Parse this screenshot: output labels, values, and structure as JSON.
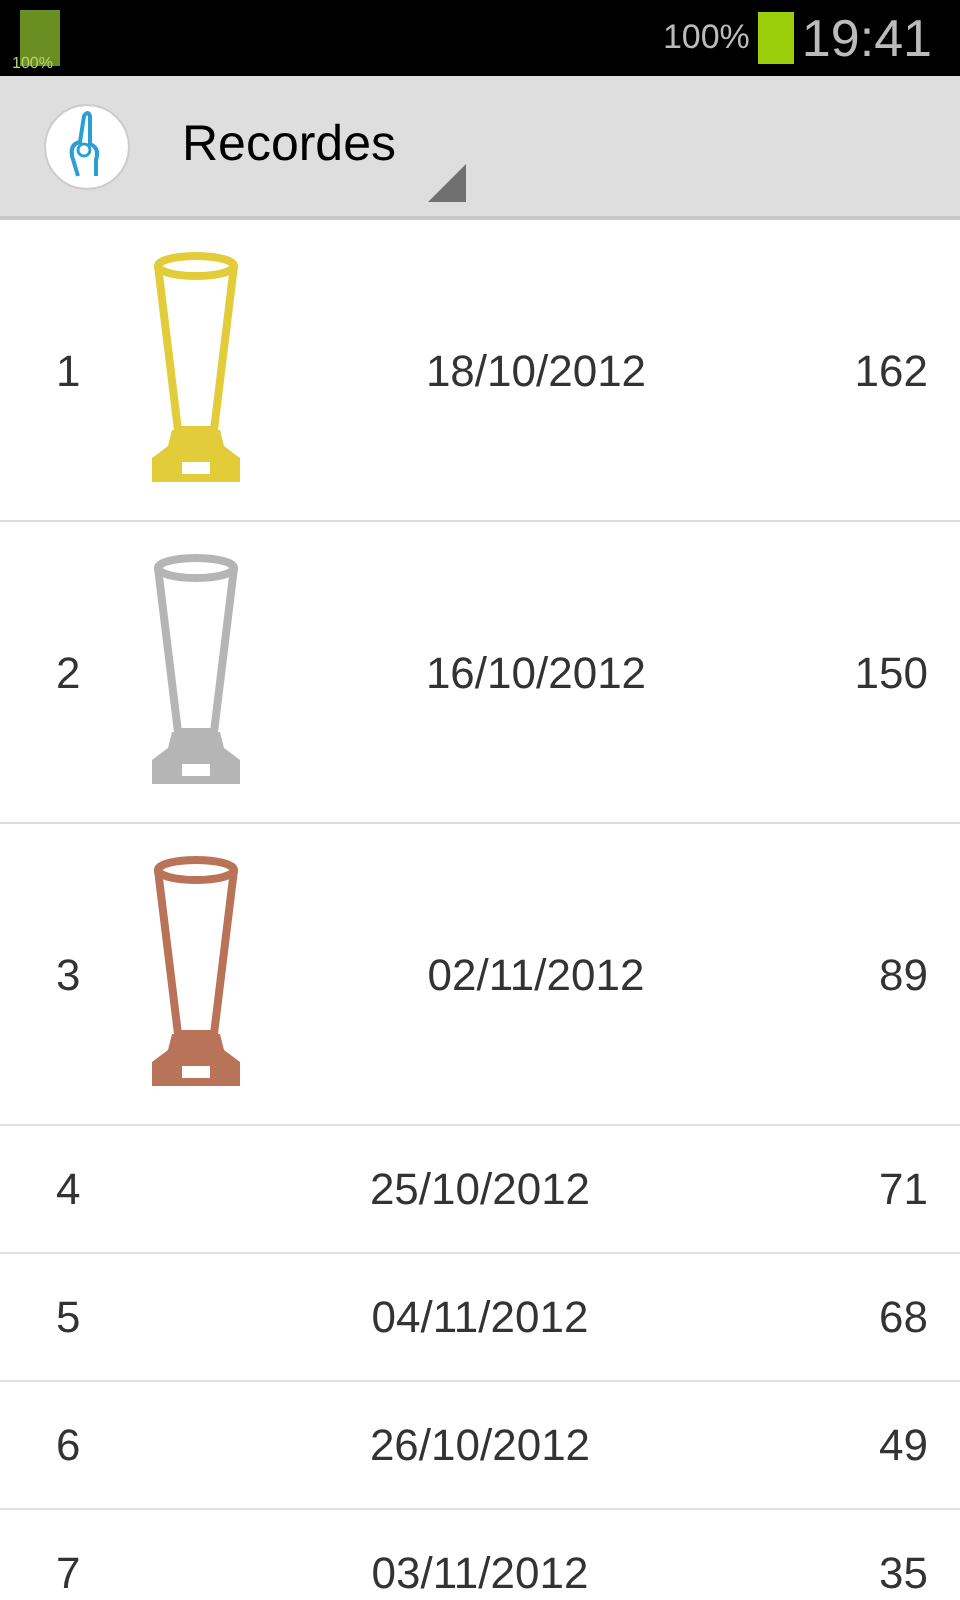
{
  "status_bar": {
    "battery_label": "100%",
    "battery_percent": "100%",
    "time": "19:41"
  },
  "action_bar": {
    "title": "Recordes"
  },
  "records": [
    {
      "kind": "trophy",
      "rank": "1",
      "date": "18/10/2012",
      "score": "162",
      "color": "#e3cc3a"
    },
    {
      "kind": "trophy",
      "rank": "2",
      "date": "16/10/2012",
      "score": "150",
      "color": "#b5b5b5"
    },
    {
      "kind": "trophy",
      "rank": "3",
      "date": "02/11/2012",
      "score": "89",
      "color": "#b87358"
    },
    {
      "kind": "plain",
      "rank": "4",
      "date": "25/10/2012",
      "score": "71"
    },
    {
      "kind": "plain",
      "rank": "5",
      "date": "04/11/2012",
      "score": "68"
    },
    {
      "kind": "plain",
      "rank": "6",
      "date": "26/10/2012",
      "score": "49"
    },
    {
      "kind": "plain",
      "rank": "7",
      "date": "03/11/2012",
      "score": "35"
    }
  ]
}
